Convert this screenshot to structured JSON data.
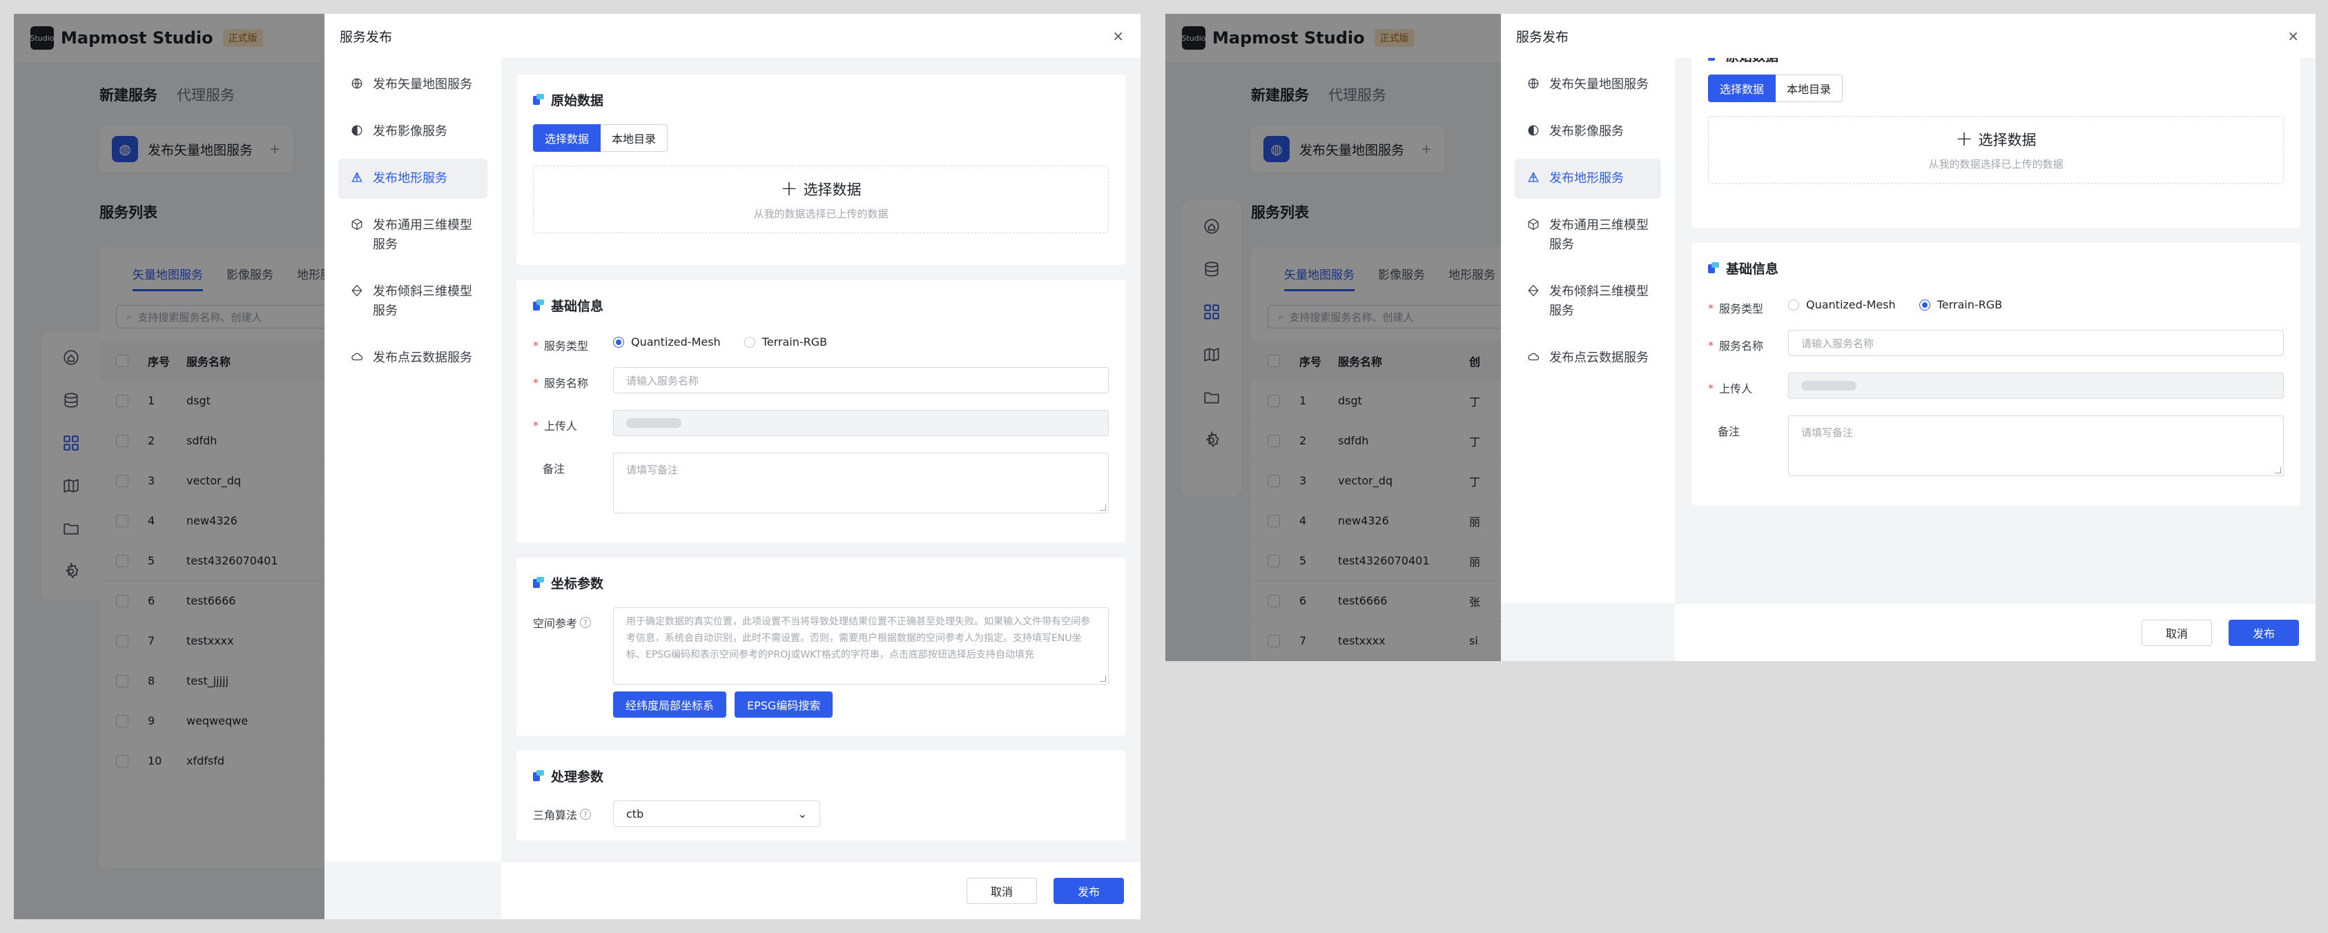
{
  "app": {
    "name": "Mapmost Studio",
    "edition": "正式版",
    "logo_text": "Studio"
  },
  "top_tabs": [
    "新建服务",
    "代理服务"
  ],
  "cards": [
    "发布矢量地图服务",
    "+"
  ],
  "service_list": {
    "title": "服务列表",
    "tabs": [
      "矢量地图服务",
      "影像服务",
      "地形服务"
    ],
    "search_placeholder": "支持搜索服务名称、创建人",
    "columns": [
      "序号",
      "服务名称",
      "创"
    ],
    "rows_a": [
      {
        "no": "1",
        "name": "dsgt"
      },
      {
        "no": "2",
        "name": "sdfdh"
      },
      {
        "no": "3",
        "name": "vector_dq"
      },
      {
        "no": "4",
        "name": "new4326"
      },
      {
        "no": "5",
        "name": "test4326070401"
      },
      {
        "no": "6",
        "name": "test6666"
      },
      {
        "no": "7",
        "name": "testxxxx"
      },
      {
        "no": "8",
        "name": "test_jjjjj"
      },
      {
        "no": "9",
        "name": "weqweqwe"
      },
      {
        "no": "10",
        "name": "xfdfsfd"
      }
    ],
    "rows_b": [
      {
        "no": "1",
        "name": "dsgt",
        "by": "丁"
      },
      {
        "no": "2",
        "name": "sdfdh",
        "by": "丁"
      },
      {
        "no": "3",
        "name": "vector_dq",
        "by": "丁"
      },
      {
        "no": "4",
        "name": "new4326",
        "by": "丽"
      },
      {
        "no": "5",
        "name": "test4326070401",
        "by": "丽"
      },
      {
        "no": "6",
        "name": "test6666",
        "by": "张"
      },
      {
        "no": "7",
        "name": "testxxxx",
        "by": "si"
      }
    ]
  },
  "drawer": {
    "title": "服务发布",
    "close": "×",
    "menu": [
      {
        "label": "发布矢量地图服务",
        "icon": "globe-icon"
      },
      {
        "label": "发布影像服务",
        "icon": "image-globe-icon"
      },
      {
        "label": "发布地形服务",
        "icon": "terrain-icon"
      },
      {
        "label": "发布通用三维模型服务",
        "icon": "cube-icon"
      },
      {
        "label": "发布倾斜三维模型服务",
        "icon": "tilt-model-icon"
      },
      {
        "label": "发布点云数据服务",
        "icon": "cloud-icon"
      }
    ],
    "raw_data": {
      "title": "原始数据",
      "seg_select": "选择数据",
      "seg_local": "本地目录",
      "drop_title": "选择数据",
      "drop_hint": "从我的数据选择已上传的数据"
    },
    "basic": {
      "title": "基础信息",
      "type_label": "服务类型",
      "type_options": [
        "Quantized-Mesh",
        "Terrain-RGB"
      ],
      "selected_a": "Quantized-Mesh",
      "selected_b": "Terrain-RGB",
      "name_label": "服务名称",
      "name_placeholder": "请输入服务名称",
      "uploader_label": "上传人",
      "note_label": "备注",
      "note_placeholder": "请填写备注"
    },
    "coords": {
      "title": "坐标参数",
      "ref_label": "空间参考",
      "ref_placeholder": "用于确定数据的真实位置，此项设置不当将导致处理结果位置不正确甚至处理失败。如果输入文件带有空间参考信息，系统会自动识别，此时不需设置。否则，需要用户根据数据的空间参考人为指定。支持填写ENU坐标、EPSG编码和表示空间参考的PROJ或WKT格式的字符串，点击底部按钮选择后支持自动填充",
      "btn_local": "经纬度局部坐标系",
      "btn_epsg": "EPSG编码搜索"
    },
    "process": {
      "title": "处理参数",
      "algo_label": "三角算法",
      "algo_value": "ctb"
    },
    "cancel": "取消",
    "publish": "发布"
  },
  "colors": {
    "accent": "#2f5bea",
    "required": "#e34d4d",
    "overlay": "rgba(0,0,0,0.45)"
  }
}
